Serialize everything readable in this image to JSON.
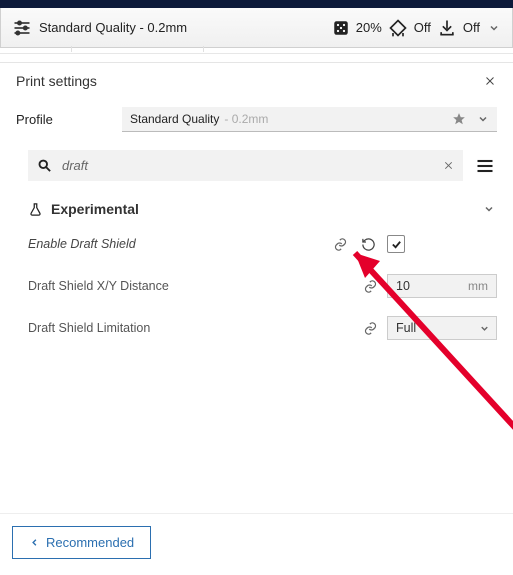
{
  "topbar": {
    "profile_label": "Standard Quality - 0.2mm",
    "infill_value": "20%",
    "support_value": "Off",
    "adhesion_value": "Off"
  },
  "panel": {
    "title": "Print settings",
    "profile_label": "Profile",
    "profile_name": "Standard Quality",
    "profile_detail": "- 0.2mm"
  },
  "search": {
    "value": "draft"
  },
  "section": {
    "title": "Experimental"
  },
  "settings": {
    "enable_draft_shield": {
      "label": "Enable Draft Shield",
      "checked": true
    },
    "draft_shield_xy": {
      "label": "Draft Shield X/Y Distance",
      "value": "10",
      "unit": "mm"
    },
    "draft_shield_limitation": {
      "label": "Draft Shield Limitation",
      "value": "Full"
    }
  },
  "footer": {
    "recommended_label": "Recommended"
  }
}
